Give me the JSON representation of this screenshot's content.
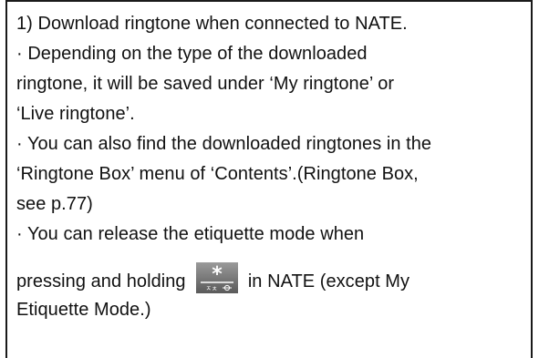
{
  "document": {
    "lines": [
      "1) Download ringtone when connected to NATE.",
      "· Depending on the type of the downloaded",
      "ringtone, it will be saved under ‘My ringtone’ or",
      "‘Live ringtone’.",
      "· You can also find the downloaded ringtones in the",
      "‘Ringtone Box’ menu of ‘Contents’.(Ringtone Box,",
      "see p.77)",
      "· You can release the etiquette mode when"
    ],
    "icon_line": {
      "before": "pressing and holding",
      "after": "in NATE (except My"
    },
    "last_line": "Etiquette Mode.)"
  },
  "key_icon": {
    "name": "star-key-icon",
    "symbol": "*",
    "sub_label": "ㅈㅊ",
    "bg_color": "#5a5a5a",
    "bg_light": "#9a9a9a",
    "fg_color": "#ffffff"
  }
}
